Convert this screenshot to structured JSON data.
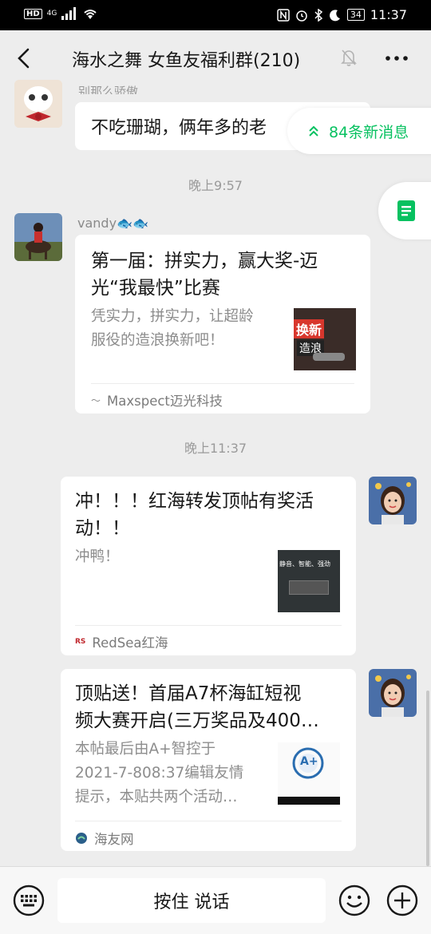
{
  "statusbar": {
    "hd": "HD",
    "net": "4G",
    "battery": "34",
    "time": "11:37"
  },
  "nav": {
    "title": "海水之舞 女鱼友福利群(210)"
  },
  "new_messages": {
    "label": "84条新消息"
  },
  "messages": [
    {
      "sender_partial": "别那么骄傲",
      "text": "不吃珊瑚，俩年多的老"
    },
    {
      "timestamp": "晚上9:57"
    },
    {
      "sender": "vandy",
      "title_line1": "第一届：拼实力，赢大奖-迈",
      "title_line2": "光“我最快”比赛",
      "desc_line1": "凭实力，拼实力，让超龄",
      "desc_line2": "服役的造浪换新吧！",
      "thumb_text1": "换新",
      "thumb_text2": "造浪",
      "source": "Maxspect迈光科技"
    },
    {
      "timestamp": "晚上11:37"
    },
    {
      "title_line1": "冲！！！红海转发顶帖有奖活",
      "title_line2": "动！！",
      "desc_line1": "冲鸭！",
      "thumb_text1": "静音、智能、强劲",
      "source": "RedSea红海"
    },
    {
      "title_line1": "顶贴送！首届A7杯海缸短视",
      "title_line2": "频大赛开启(三万奖品及400…",
      "desc_line1": "本帖最后由A+智控于",
      "desc_line2": "2021-7-808:37编辑友情",
      "desc_line3": "提示，本贴共两个活动…",
      "thumb_text1": "A+",
      "source": "海友网"
    }
  ],
  "bottom": {
    "talk_label": "按住 说话"
  },
  "colors": {
    "accent": "#07c160",
    "background": "#ededed"
  }
}
